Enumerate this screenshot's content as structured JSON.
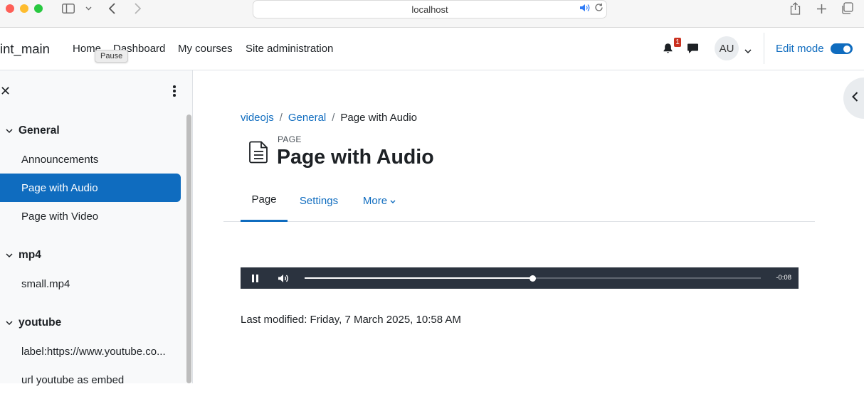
{
  "browser": {
    "url": "localhost"
  },
  "navbar": {
    "brand": "int_main",
    "links": [
      "Home",
      "Dashboard",
      "My courses",
      "Site administration"
    ],
    "tooltip": "Pause",
    "notification_count": "1",
    "avatar_initials": "AU",
    "edit_mode_label": "Edit mode",
    "edit_mode_on": true
  },
  "drawer": {
    "sections": [
      {
        "title": "General",
        "items": [
          "Announcements",
          "Page with Audio",
          "Page with Video"
        ]
      },
      {
        "title": "mp4",
        "items": [
          "small.mp4"
        ]
      },
      {
        "title": "youtube",
        "items": [
          "label:https://www.youtube.co...",
          "url youtube as embed"
        ]
      }
    ],
    "active_item": "Page with Audio"
  },
  "breadcrumb": [
    "videojs",
    "General",
    "Page with Audio"
  ],
  "page": {
    "kicker": "PAGE",
    "title": "Page with Audio",
    "tabs": [
      "Page",
      "Settings",
      "More"
    ],
    "active_tab": "Page"
  },
  "player": {
    "state": "playing",
    "remaining": "-0:08",
    "progress": 0.5
  },
  "last_modified": "Last modified: Friday, 7 March 2025, 10:58 AM",
  "colors": {
    "accent": "#0f6cbf",
    "player_bg": "#2b333f",
    "badge": "#ca3120"
  }
}
